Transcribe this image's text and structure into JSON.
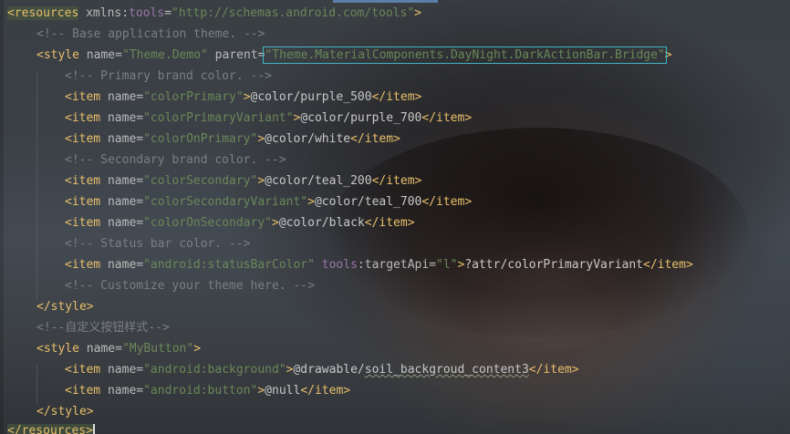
{
  "code": {
    "l1": {
      "open": "<resources",
      "space": " ",
      "attr": "xmlns:",
      "ns": "tools",
      "eq": "=",
      "val": "\"http://schemas.android.com/tools\"",
      "close": ">"
    },
    "l2": {
      "comment": "<!-- Base application theme. -->"
    },
    "l3": {
      "open": "<style",
      "attr1": " name=",
      "val1": "\"Theme.Demo\"",
      "attr2": " parent=",
      "val2": "\"Theme.MaterialComponents.DayNight.DarkActionBar.Bridge\"",
      "close": ">"
    },
    "l4": {
      "comment": "<!-- Primary brand color. -->"
    },
    "l5": {
      "open": "<item",
      "attr": " name=",
      "val": "\"colorPrimary\"",
      "gt": ">",
      "text": "@color/purple_500",
      "close": "</item>"
    },
    "l6": {
      "open": "<item",
      "attr": " name=",
      "val": "\"colorPrimaryVariant\"",
      "gt": ">",
      "text": "@color/purple_700",
      "close": "</item>"
    },
    "l7": {
      "open": "<item",
      "attr": " name=",
      "val": "\"colorOnPrimary\"",
      "gt": ">",
      "text": "@color/white",
      "close": "</item>"
    },
    "l8": {
      "comment": "<!-- Secondary brand color. -->"
    },
    "l9": {
      "open": "<item",
      "attr": " name=",
      "val": "\"colorSecondary\"",
      "gt": ">",
      "text": "@color/teal_200",
      "close": "</item>"
    },
    "l10": {
      "open": "<item",
      "attr": " name=",
      "val": "\"colorSecondaryVariant\"",
      "gt": ">",
      "text": "@color/teal_700",
      "close": "</item>"
    },
    "l11": {
      "open": "<item",
      "attr": " name=",
      "val": "\"colorOnSecondary\"",
      "gt": ">",
      "text": "@color/black",
      "close": "</item>"
    },
    "l12": {
      "comment": "<!-- Status bar color. -->"
    },
    "l13": {
      "open": "<item",
      "attr": " name=",
      "val": "\"android:statusBarColor\"",
      "ns": " tools",
      "attr2": ":targetApi=",
      "val2": "\"l\"",
      "gt": ">",
      "text": "?attr/colorPrimaryVariant",
      "close": "</item>"
    },
    "l14": {
      "comment": "<!-- Customize your theme here. -->"
    },
    "l15": {
      "close": "</style>"
    },
    "l16": {
      "comment": "<!--自定义按钮样式-->"
    },
    "l17": {
      "open": "<style",
      "attr": " name=",
      "val": "\"MyButton\"",
      "close": ">"
    },
    "l18": {
      "open": "<item",
      "attr": " name=",
      "val": "\"android:background\"",
      "gt": ">",
      "text_a": "@drawable/",
      "text_b": "soil_backgroud_content3",
      "close": "</item>"
    },
    "l19": {
      "open": "<item",
      "attr": " name=",
      "val": "\"android:button\"",
      "gt": ">",
      "text": "@null",
      "close": "</item>"
    },
    "l20": {
      "close": "</style>"
    },
    "l21": {
      "close": "</resources>"
    }
  },
  "colors": {
    "tag": "#e8bf6a",
    "string": "#6a8759",
    "comment": "#7a7e85",
    "namespace": "#9876aa",
    "highlight_box": "#3fb5c4"
  }
}
